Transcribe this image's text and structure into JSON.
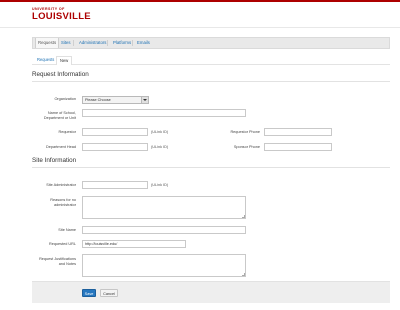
{
  "brand": {
    "univ": "UNIVERSITY OF",
    "name": "LOUISVILLE",
    "color": "#ad0000"
  },
  "nav": {
    "tabs": [
      "Requests",
      "Sites",
      "Administrators",
      "Platforms",
      "Emails"
    ],
    "active": "Requests"
  },
  "subnav": {
    "link": "Requests",
    "current": "New"
  },
  "request_section": {
    "title": "Request Information",
    "organization": {
      "label": "Organization",
      "value": "Please Choose"
    },
    "school": {
      "label": "Name of School, Department or Unit",
      "value": ""
    },
    "requestor": {
      "label": "Requestor",
      "value": "",
      "hint": "(ULink ID)"
    },
    "requestor_phone": {
      "label": "Requestor Phone",
      "value": ""
    },
    "department_head": {
      "label": "Department Head",
      "value": "",
      "hint": "(ULink ID)"
    },
    "sponsor_phone": {
      "label": "Sponsor Phone",
      "value": ""
    }
  },
  "site_section": {
    "title": "Site Information",
    "site_admin": {
      "label": "Site Administrator",
      "value": "",
      "hint": "(ULink ID)"
    },
    "reasons": {
      "label": "Reasons for no administrator"
    },
    "site_name": {
      "label": "Site Name",
      "value": ""
    },
    "requested_url": {
      "label": "Requested URL",
      "value": "http://louisville.edu/"
    },
    "justifications": {
      "label": "Request Justifications and Notes"
    }
  },
  "actions": {
    "save": "Save",
    "cancel": "Cancel"
  }
}
